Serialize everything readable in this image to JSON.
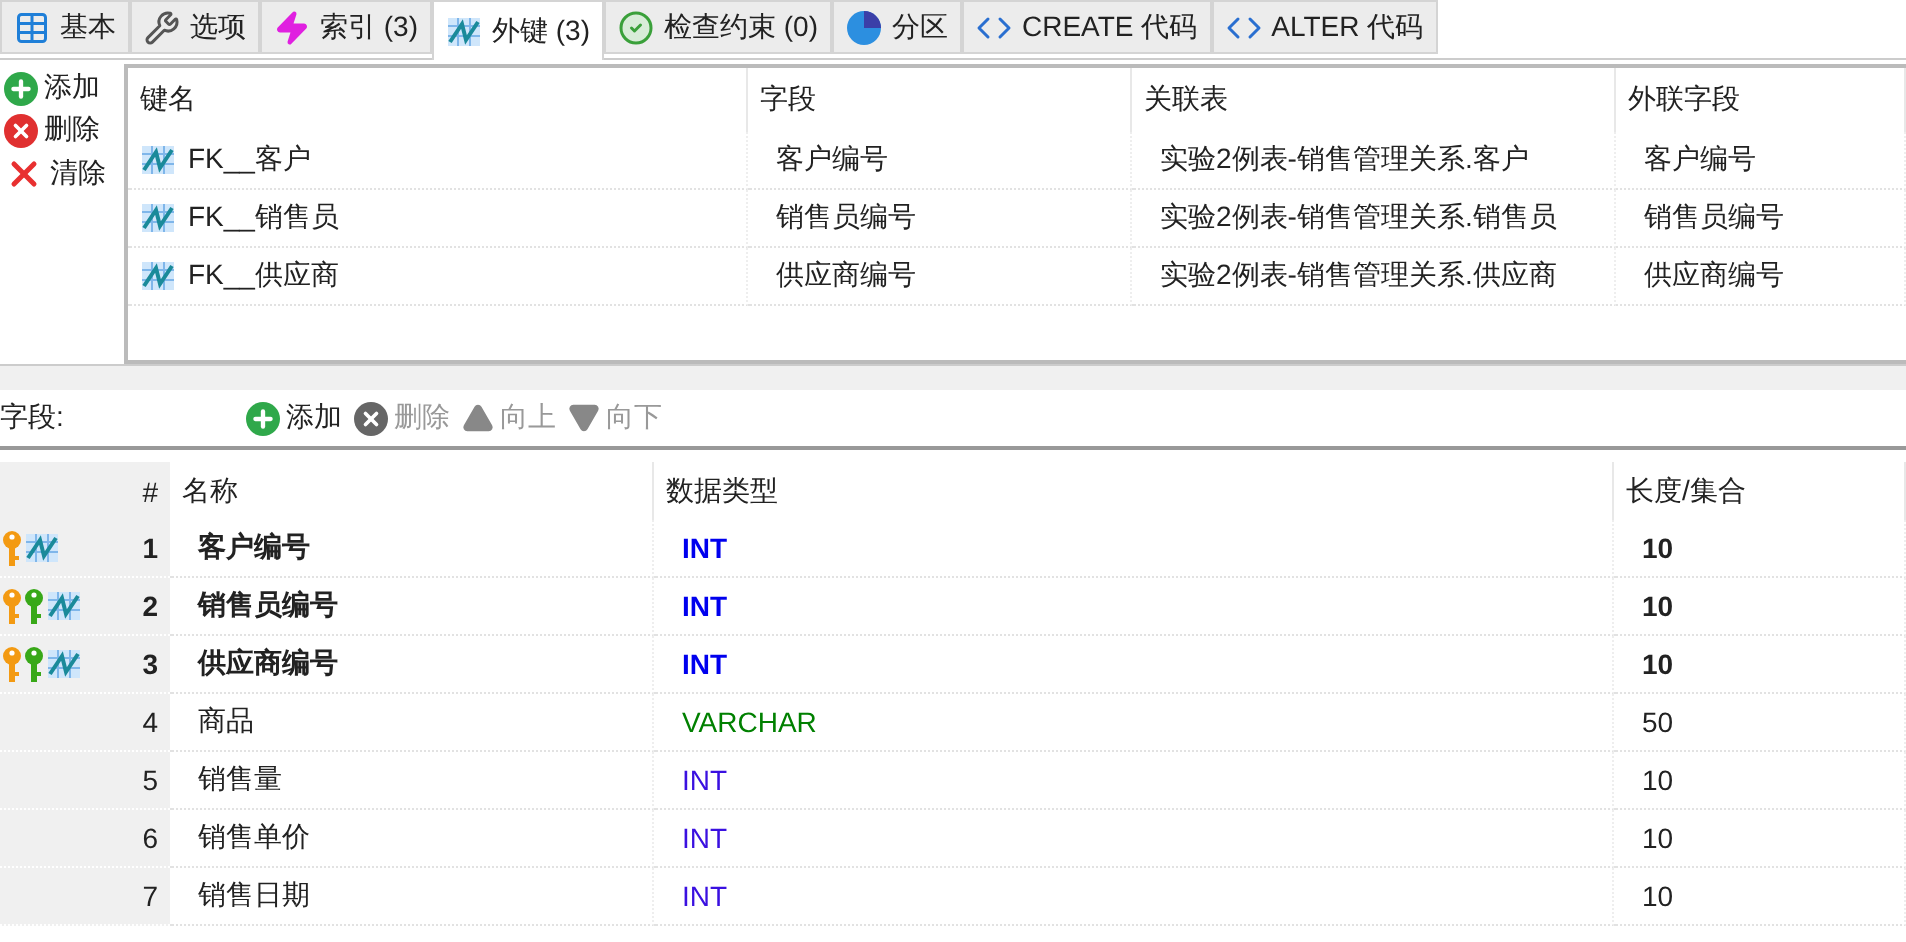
{
  "tabs": [
    {
      "label": "基本",
      "selected": false
    },
    {
      "label": "选项",
      "selected": false
    },
    {
      "label": "索引 (3)",
      "selected": false
    },
    {
      "label": "外键 (3)",
      "selected": true
    },
    {
      "label": "检查约束 (0)",
      "selected": false
    },
    {
      "label": "分区",
      "selected": false
    },
    {
      "label": "CREATE 代码",
      "selected": false
    },
    {
      "label": "ALTER 代码",
      "selected": false
    }
  ],
  "fk_actions": [
    {
      "label": "添加",
      "kind": "add"
    },
    {
      "label": "删除",
      "kind": "delete"
    },
    {
      "label": "清除",
      "kind": "clear"
    }
  ],
  "foreign_keys": {
    "columns": [
      "键名",
      "字段",
      "关联表",
      "外联字段"
    ],
    "rows": [
      {
        "name": "FK__客户",
        "field": "客户编号",
        "ref_table": "实验2例表-销售管理关系.客户",
        "ref_field": "客户编号"
      },
      {
        "name": "FK__销售员",
        "field": "销售员编号",
        "ref_table": "实验2例表-销售管理关系.销售员",
        "ref_field": "销售员编号"
      },
      {
        "name": "FK__供应商",
        "field": "供应商编号",
        "ref_table": "实验2例表-销售管理关系.供应商",
        "ref_field": "供应商编号"
      }
    ]
  },
  "fields_toolbar": {
    "label": "字段:",
    "buttons": [
      {
        "label": "添加",
        "kind": "add",
        "disabled": false
      },
      {
        "label": "删除",
        "kind": "delete",
        "disabled": true
      },
      {
        "label": "向上",
        "kind": "up",
        "disabled": true
      },
      {
        "label": "向下",
        "kind": "down",
        "disabled": true
      }
    ]
  },
  "fields": {
    "columns": [
      "#",
      "名称",
      "数据类型",
      "长度/集合"
    ],
    "rows": [
      {
        "number": "1",
        "name": "客户编号",
        "type": "INT",
        "length": "10",
        "primary_key": true,
        "index_key": false,
        "foreign_key": true,
        "color": "#0000ee"
      },
      {
        "number": "2",
        "name": "销售员编号",
        "type": "INT",
        "length": "10",
        "primary_key": true,
        "index_key": true,
        "foreign_key": true,
        "color": "#0000ee"
      },
      {
        "number": "3",
        "name": "供应商编号",
        "type": "INT",
        "length": "10",
        "primary_key": true,
        "index_key": true,
        "foreign_key": true,
        "color": "#0000ee"
      },
      {
        "number": "4",
        "name": "商品",
        "type": "VARCHAR",
        "length": "50",
        "primary_key": false,
        "index_key": false,
        "foreign_key": false,
        "color": "#008000"
      },
      {
        "number": "5",
        "name": "销售量",
        "type": "INT",
        "length": "10",
        "primary_key": false,
        "index_key": false,
        "foreign_key": false,
        "color": "#3a10e0"
      },
      {
        "number": "6",
        "name": "销售单价",
        "type": "INT",
        "length": "10",
        "primary_key": false,
        "index_key": false,
        "foreign_key": false,
        "color": "#3a10e0"
      },
      {
        "number": "7",
        "name": "销售日期",
        "type": "INT",
        "length": "10",
        "primary_key": false,
        "index_key": false,
        "foreign_key": false,
        "color": "#3a10e0"
      }
    ]
  }
}
